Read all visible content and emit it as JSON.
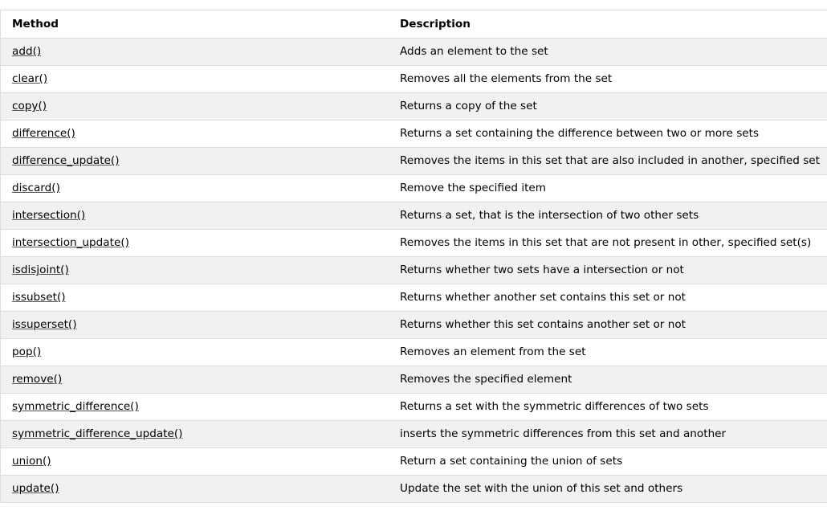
{
  "table": {
    "headers": [
      "Method",
      "Description"
    ],
    "rows": [
      {
        "method": "add()",
        "description": "Adds an element to the set"
      },
      {
        "method": "clear()",
        "description": "Removes all the elements from the set"
      },
      {
        "method": "copy()",
        "description": "Returns a copy of the set"
      },
      {
        "method": "difference()",
        "description": "Returns a set containing the difference between two or more sets"
      },
      {
        "method": "difference_update()",
        "description": "Removes the items in this set that are also included in another, specified set"
      },
      {
        "method": "discard()",
        "description": "Remove the specified item"
      },
      {
        "method": "intersection()",
        "description": "Returns a set, that is the intersection of two other sets"
      },
      {
        "method": "intersection_update()",
        "description": "Removes the items in this set that are not present in other, specified set(s)"
      },
      {
        "method": "isdisjoint()",
        "description": "Returns whether two sets have a intersection or not"
      },
      {
        "method": "issubset()",
        "description": "Returns whether another set contains this set or not"
      },
      {
        "method": "issuperset()",
        "description": "Returns whether this set contains another set or not"
      },
      {
        "method": "pop()",
        "description": "Removes an element from the set"
      },
      {
        "method": "remove()",
        "description": "Removes the specified element"
      },
      {
        "method": "symmetric_difference()",
        "description": "Returns a set with the symmetric differences of two sets"
      },
      {
        "method": "symmetric_difference_update()",
        "description": "inserts the symmetric differences from this set and another"
      },
      {
        "method": "union()",
        "description": "Return a set containing the union of sets"
      },
      {
        "method": "update()",
        "description": "Update the set with the union of this set and others"
      }
    ]
  }
}
